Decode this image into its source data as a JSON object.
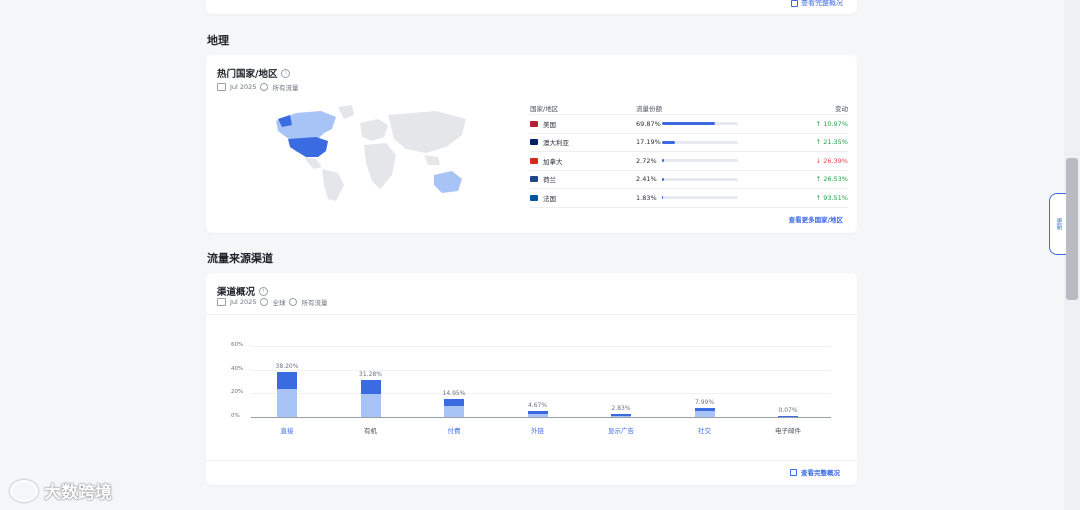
{
  "top_card": {
    "link": "查看完整概况"
  },
  "geo": {
    "section_title": "地理",
    "card_title": "热门国家/地区",
    "date": "Jul 2025",
    "traffic": "所有流量",
    "table": {
      "headers": {
        "country": "国家/地区",
        "share": "流量份额",
        "change": "变动"
      },
      "rows": [
        {
          "country": "美国",
          "flag_color": "#b22234",
          "share": "69.87%",
          "share_value": 69.87,
          "change": "10.97%",
          "dir": "up",
          "arrow": "↑"
        },
        {
          "country": "澳大利亚",
          "flag_color": "#012169",
          "share": "17.19%",
          "share_value": 17.19,
          "change": "21.35%",
          "dir": "up",
          "arrow": "↑"
        },
        {
          "country": "加拿大",
          "flag_color": "#d52b1e",
          "share": "2.72%",
          "share_value": 2.72,
          "change": "26.39%",
          "dir": "down",
          "arrow": "↓"
        },
        {
          "country": "荷兰",
          "flag_color": "#21468b",
          "share": "2.41%",
          "share_value": 2.41,
          "change": "26.53%",
          "dir": "up",
          "arrow": "↑"
        },
        {
          "country": "法国",
          "flag_color": "#0055a4",
          "share": "1.83%",
          "share_value": 1.83,
          "change": "93.51%",
          "dir": "up",
          "arrow": "↑"
        }
      ]
    },
    "more_link": "查看更多国家/地区"
  },
  "channels": {
    "section_title": "流量来源渠道",
    "card_title": "渠道概况",
    "date": "Jul 2025",
    "region": "全球",
    "traffic": "所有流量",
    "view_all": "查看完整概况"
  },
  "chart_data": {
    "type": "bar",
    "categories": [
      "直接",
      "有机",
      "付费",
      "外链",
      "显示广告",
      "社交",
      "电子邮件"
    ],
    "values": [
      38.2,
      31.28,
      14.95,
      4.67,
      2.83,
      7.99,
      0.07
    ],
    "labels": [
      "38.20%",
      "31.28%",
      "14.95%",
      "4.67%",
      "2.83%",
      "7.99%",
      "0.07%"
    ],
    "y_ticks": [
      "60%",
      "40%",
      "20%",
      "0%"
    ],
    "ylim": [
      0,
      60
    ],
    "colors": {
      "top": "#3b6be0",
      "bottom": "#a8c3f6"
    },
    "link_categories": [
      true,
      false,
      true,
      true,
      true,
      true,
      false
    ]
  },
  "watermark": "大数跨境",
  "side_widget": "更新"
}
